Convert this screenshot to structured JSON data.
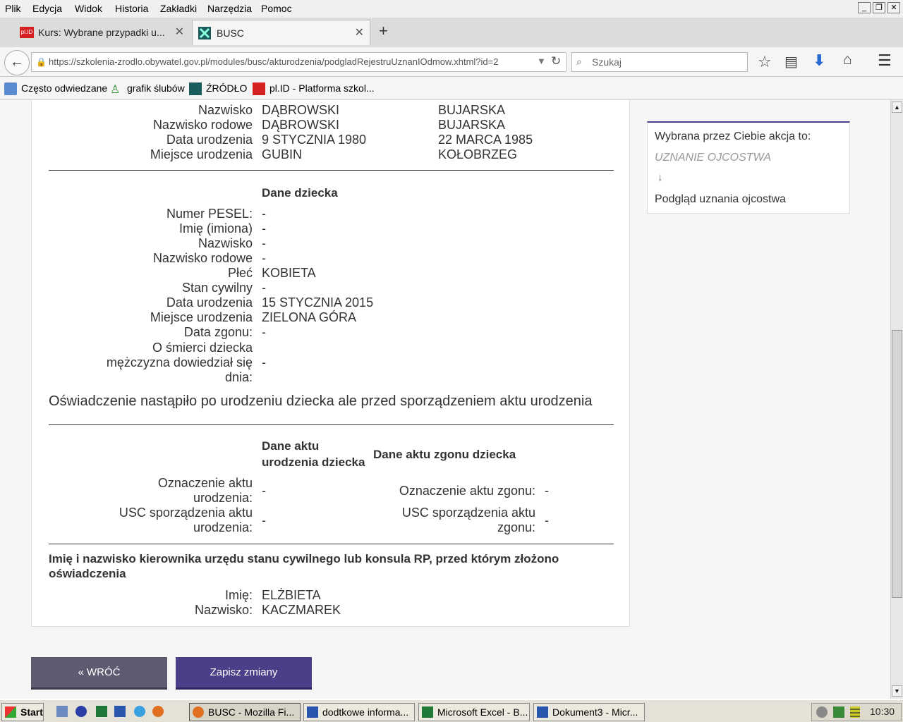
{
  "menu": {
    "items": [
      "Plik",
      "Edycja",
      "Widok",
      "Historia",
      "Zakładki",
      "Narzędzia",
      "Pomoc"
    ]
  },
  "tabs": [
    {
      "label": "Kurs: Wybrane przypadki u...",
      "icon": "plid-icon"
    },
    {
      "label": "BUSC",
      "icon": "busc-icon"
    }
  ],
  "nav": {
    "url": "https://szkolenia-zrodlo.obywatel.gov.pl/modules/busc/akturodzenia/podgladRejestruUznanIOdmow.xhtml?id=2",
    "search_placeholder": "Szukaj"
  },
  "bookmarks": [
    "Często odwiedzane",
    "grafik ślubów",
    "ŹRÓDŁO",
    "pl.ID - Platforma szkol..."
  ],
  "parents": {
    "rows": [
      {
        "label": "Nazwisko",
        "father": "DĄBROWSKI",
        "mother": "BUJARSKA"
      },
      {
        "label": "Nazwisko rodowe",
        "father": "DĄBROWSKI",
        "mother": "BUJARSKA"
      },
      {
        "label": "Data urodzenia",
        "father": "9 STYCZNIA 1980",
        "mother": "22 MARCA 1985"
      },
      {
        "label": "Miejsce urodzenia",
        "father": "GUBIN",
        "mother": "KOŁOBRZEG"
      }
    ]
  },
  "child": {
    "heading": "Dane dziecka",
    "rows": [
      {
        "label": "Numer PESEL:",
        "value": "-"
      },
      {
        "label": "Imię (imiona)",
        "value": "-"
      },
      {
        "label": "Nazwisko",
        "value": "-"
      },
      {
        "label": "Nazwisko rodowe",
        "value": "-"
      },
      {
        "label": "Płeć",
        "value": "KOBIETA"
      },
      {
        "label": "Stan cywilny",
        "value": "-"
      },
      {
        "label": "Data urodzenia",
        "value": "15 STYCZNIA 2015"
      },
      {
        "label": "Miejsce urodzenia",
        "value": "ZIELONA GÓRA"
      },
      {
        "label": "Data zgonu:",
        "value": "-"
      }
    ],
    "death_knowledge_lines": [
      "O śmierci dziecka",
      "mężczyzna dowiedział się",
      "dnia:"
    ],
    "death_knowledge_value": "-"
  },
  "statement": "Oświadczenie nastąpiło po urodzeniu dziecka ale przed sporządzeniem aktu urodzenia",
  "acts": {
    "birth_heading_lines": [
      "Dane aktu",
      "urodzenia dziecka"
    ],
    "death_heading": "Dane aktu zgonu dziecka",
    "birth_mark_lines": [
      "Oznaczenie aktu",
      "urodzenia:"
    ],
    "birth_mark_value": "-",
    "birth_usc_lines": [
      "USC sporządzenia aktu",
      "urodzenia:"
    ],
    "birth_usc_value": "-",
    "death_mark": "Oznaczenie aktu zgonu:",
    "death_mark_value": "-",
    "death_usc_lines": [
      "USC sporządzenia aktu",
      "zgonu:"
    ],
    "death_usc_value": "-"
  },
  "registrar": {
    "heading_lines": [
      "Imię i nazwisko kierownika urzędu stanu cywilnego lub konsula RP, przed którym złożono",
      "oświadczenia"
    ],
    "first_label": "Imię:",
    "first_value": "ELŻBIETA",
    "last_label": "Nazwisko:",
    "last_value": "KACZMAREK"
  },
  "sidebar": {
    "intro": "Wybrana przez Ciebie akcja to:",
    "action": "UZNANIE OJCOSTWA",
    "arrow": "↓",
    "result": "Podgląd uznania ojcostwa"
  },
  "buttons": {
    "back": "« WRÓĆ",
    "save": "Zapisz zmiany"
  },
  "taskbar": {
    "start": "Start",
    "items": [
      "BUSC - Mozilla Fi...",
      "dodtkowe informa...",
      "Microsoft Excel - B...",
      "Dokument3 - Micr..."
    ],
    "clock": "10:30"
  },
  "colors": {
    "accent": "#4b3f8a",
    "back_button": "#5f5a6f",
    "save_button": "#4b3f8a"
  }
}
